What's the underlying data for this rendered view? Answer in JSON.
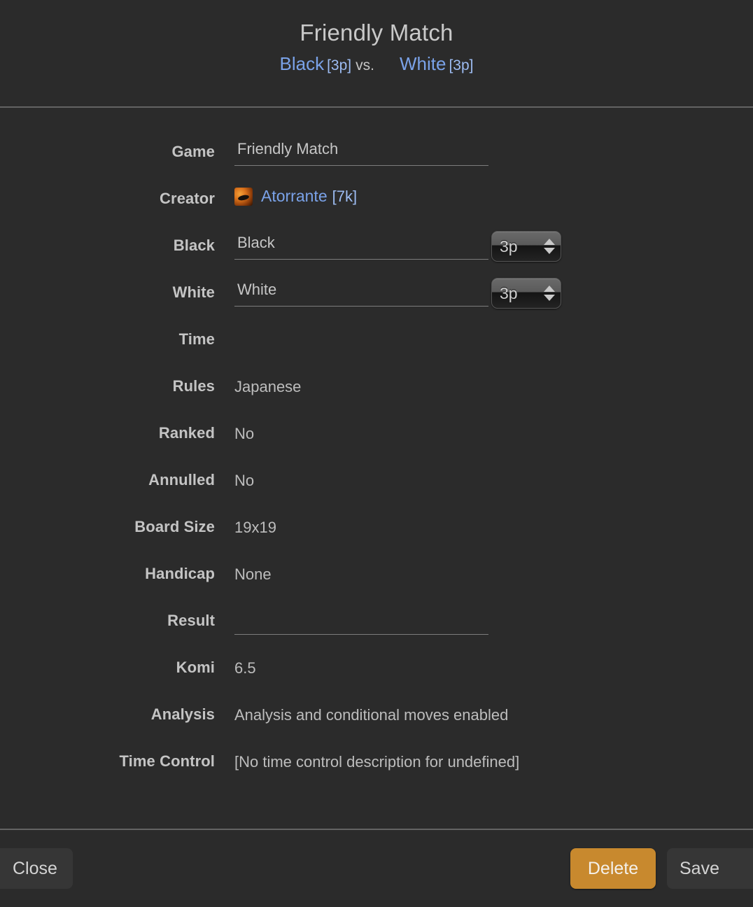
{
  "header": {
    "title": "Friendly Match",
    "black_player": "Black",
    "black_rank": "[3p]",
    "vs": "vs.",
    "white_player": "White",
    "white_rank": "[3p]"
  },
  "fields": {
    "game": {
      "label": "Game",
      "value": "Friendly Match"
    },
    "creator": {
      "label": "Creator",
      "avatar_icon": "flame-avatar-icon",
      "name": "Atorrante",
      "rank": "[7k]"
    },
    "black": {
      "label": "Black",
      "value": "Black",
      "rank": "3p",
      "stepper_up_icon": "caret-up-icon",
      "stepper_down_icon": "caret-down-icon"
    },
    "white": {
      "label": "White",
      "value": "White",
      "rank": "3p",
      "stepper_up_icon": "caret-up-icon",
      "stepper_down_icon": "caret-down-icon"
    },
    "time": {
      "label": "Time",
      "value": ""
    },
    "rules": {
      "label": "Rules",
      "value": "Japanese"
    },
    "ranked": {
      "label": "Ranked",
      "value": "No"
    },
    "annulled": {
      "label": "Annulled",
      "value": "No"
    },
    "board_size": {
      "label": "Board Size",
      "value": "19x19"
    },
    "handicap": {
      "label": "Handicap",
      "value": "None"
    },
    "result": {
      "label": "Result",
      "value": ""
    },
    "komi": {
      "label": "Komi",
      "value": "6.5"
    },
    "analysis": {
      "label": "Analysis",
      "value": "Analysis and conditional moves enabled"
    },
    "time_control": {
      "label": "Time Control",
      "value": "[No time control description for undefined]"
    }
  },
  "footer": {
    "close_label": "Close",
    "delete_label": "Delete",
    "save_label": "Save"
  },
  "colors": {
    "background": "#2b2b2b",
    "divider": "#636363",
    "link": "#7aa2e8",
    "rank": "#9dbcf2",
    "label": "#c4c4c4",
    "value": "#bdbdbd",
    "delete_accent": "#c8892e",
    "button_dark": "#363636"
  }
}
